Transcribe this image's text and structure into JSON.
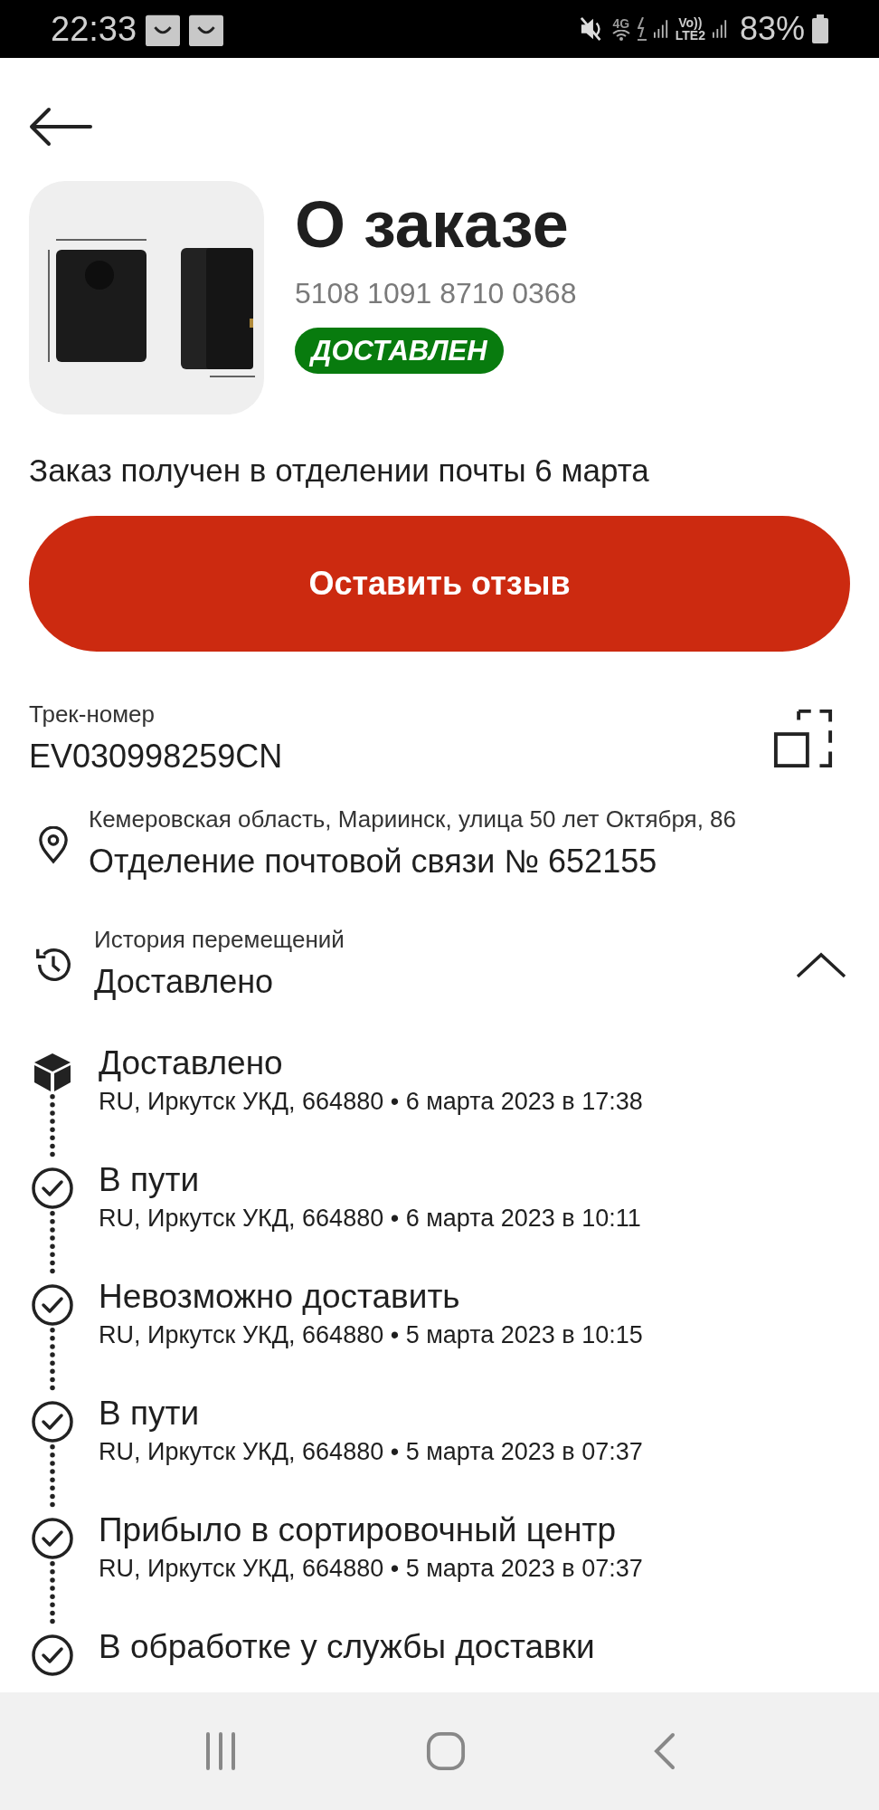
{
  "status_bar": {
    "time": "22:33",
    "network_label": "4G",
    "volte_label": "Vo))",
    "lte_label": "LTE2",
    "battery": "83%"
  },
  "order": {
    "title": "О заказе",
    "number": "5108 1091 8710 0368",
    "status_badge": "ДОСТАВЛЕН",
    "message": "Заказ получен в отделении почты 6 марта",
    "review_button": "Оставить отзыв"
  },
  "tracking": {
    "label": "Трек-номер",
    "value": "EV030998259CN"
  },
  "pickup": {
    "address": "Кемеровская область, Мариинск, улица 50 лет Октября, 86",
    "office": "Отделение почтовой связи № 652155"
  },
  "history": {
    "label": "История перемещений",
    "current": "Доставлено",
    "expanded": true,
    "events": [
      {
        "kind": "delivered",
        "title": "Доставлено",
        "details": "RU, Иркутск УКД, 664880 • 6 марта 2023 в 17:38"
      },
      {
        "kind": "check",
        "title": "В пути",
        "details": "RU, Иркутск УКД, 664880 • 6 марта 2023 в 10:11"
      },
      {
        "kind": "check",
        "title": "Невозможно доставить",
        "details": "RU, Иркутск УКД, 664880 • 5 марта 2023 в 10:15"
      },
      {
        "kind": "check",
        "title": "В пути",
        "details": "RU, Иркутск УКД, 664880 • 5 марта 2023 в 07:37"
      },
      {
        "kind": "check",
        "title": "Прибыло в сортировочный центр",
        "details": "RU, Иркутск УКД, 664880 • 5 марта 2023 в 07:37"
      },
      {
        "kind": "check",
        "title": "В обработке у службы доставки"
      }
    ]
  }
}
